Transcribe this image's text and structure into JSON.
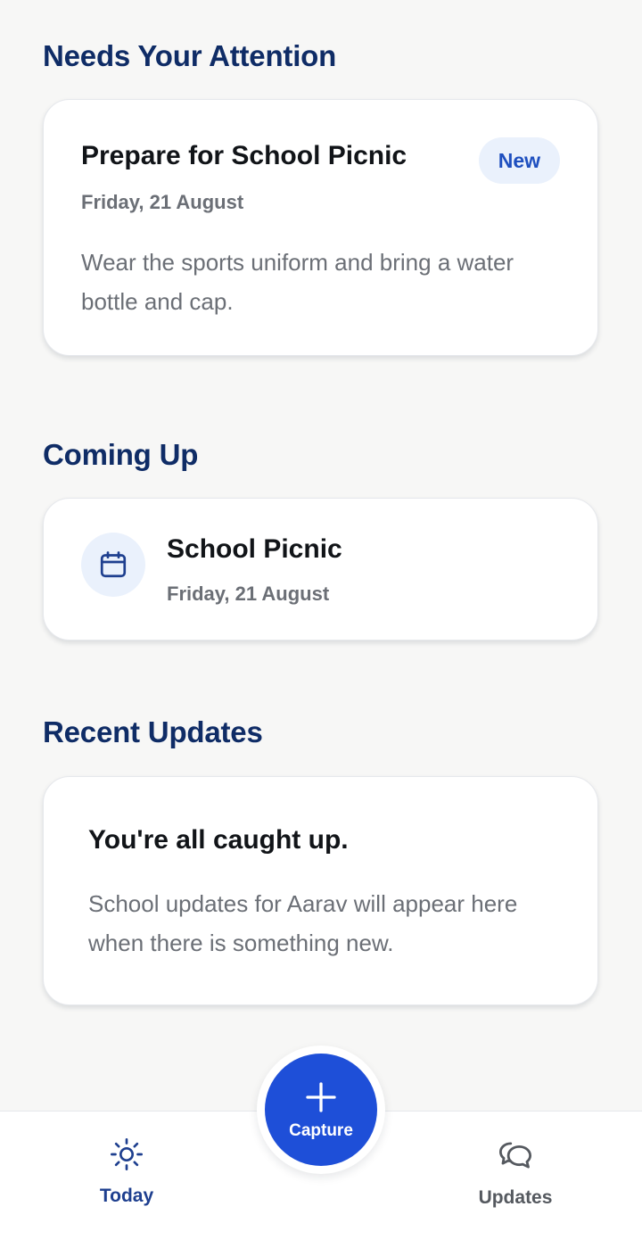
{
  "sections": {
    "attention": {
      "title": "Needs Your Attention",
      "card": {
        "title": "Prepare for School Picnic",
        "badge": "New",
        "date": "Friday, 21 August",
        "description": "Wear the sports uniform and bring a water bottle and cap."
      }
    },
    "coming_up": {
      "title": "Coming Up",
      "event": {
        "icon": "calendar-icon",
        "title": "School Picnic",
        "date": "Friday, 21 August"
      }
    },
    "recent_updates": {
      "title": "Recent Updates",
      "empty_state": {
        "title": "You're all caught up.",
        "body": "School updates for Aarav will appear here when there is something new."
      }
    }
  },
  "bottom_nav": {
    "items": [
      {
        "label": "Today",
        "icon": "sun-icon",
        "active": true
      },
      {
        "label": "Updates",
        "icon": "chat-bubbles-icon",
        "active": false
      }
    ],
    "fab": {
      "label": "Capture",
      "icon": "plus-icon"
    }
  },
  "colors": {
    "heading": "#0f2c66",
    "accent": "#1e4fd8",
    "badge_bg": "#eaf1fc",
    "badge_text": "#1e4fbf",
    "muted_text": "#6b6f76",
    "background": "#f7f7f6"
  }
}
